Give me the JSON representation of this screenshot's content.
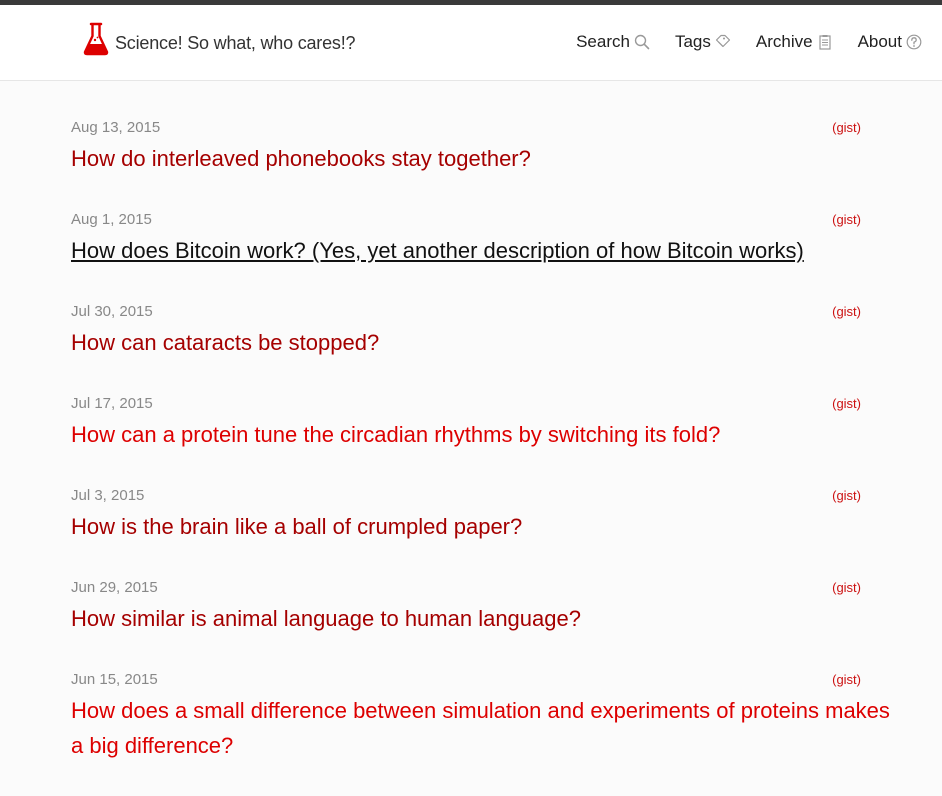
{
  "header": {
    "site_title": "Science! So what, who cares!?",
    "nav": [
      {
        "label": "Search",
        "icon": "search-icon"
      },
      {
        "label": "Tags",
        "icon": "tag-icon"
      },
      {
        "label": "Archive",
        "icon": "archive-icon"
      },
      {
        "label": "About",
        "icon": "question-icon"
      }
    ]
  },
  "colors": {
    "accent": "#a50000",
    "accent_bright": "#dd0000",
    "gist": "#cc1111",
    "date": "#888888"
  },
  "posts": [
    {
      "date": "Aug 13, 2015",
      "gist": "(gist)",
      "title": "How do interleaved phonebooks stay together?"
    },
    {
      "date": "Aug 1, 2015",
      "gist": "(gist)",
      "title": "How does Bitcoin work? (Yes, yet another description of how Bitcoin works)"
    },
    {
      "date": "Jul 30, 2015",
      "gist": "(gist)",
      "title": "How can cataracts be stopped?"
    },
    {
      "date": "Jul 17, 2015",
      "gist": "(gist)",
      "title": "How can a protein tune the circadian rhythms by switching its fold?"
    },
    {
      "date": "Jul 3, 2015",
      "gist": "(gist)",
      "title": "How is the brain like a ball of crumpled paper?"
    },
    {
      "date": "Jun 29, 2015",
      "gist": "(gist)",
      "title": "How similar is animal language to human language?"
    },
    {
      "date": "Jun 15, 2015",
      "gist": "(gist)",
      "title": "How does a small difference between simulation and experiments of proteins makes a big difference?"
    }
  ]
}
